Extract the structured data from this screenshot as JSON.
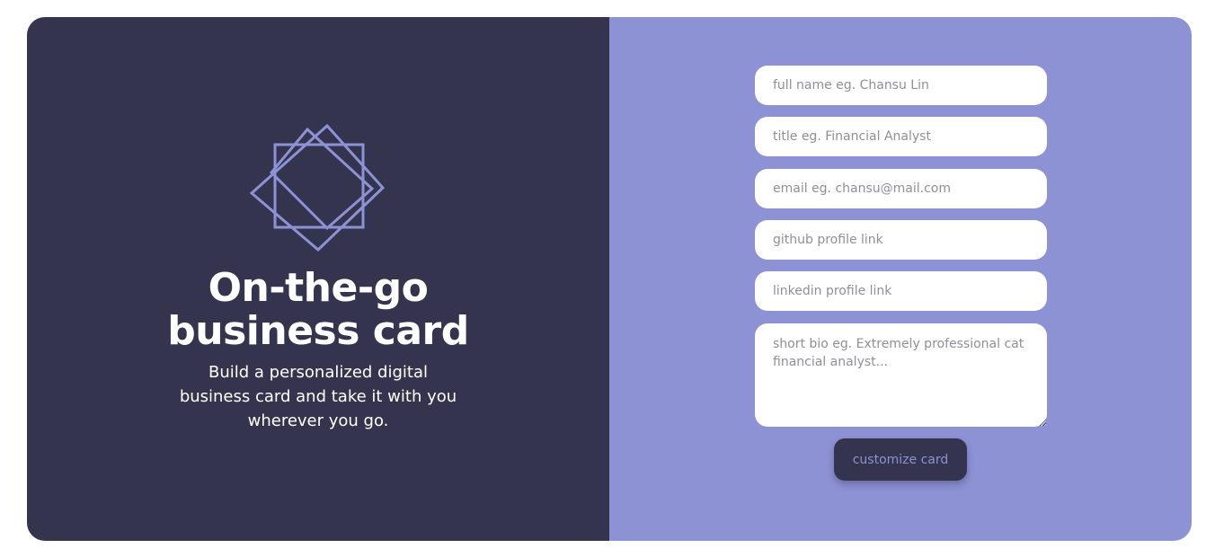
{
  "hero": {
    "logo_icon": "overlapping-squares-icon",
    "title_line1": "On-the-go",
    "title_line2": "business card",
    "subtitle": "Build a personalized digital business card and take it with you wherever you go."
  },
  "form": {
    "full_name": {
      "value": "",
      "placeholder": "full name eg. Chansu Lin"
    },
    "title": {
      "value": "",
      "placeholder": "title eg. Financial Analyst"
    },
    "email": {
      "value": "",
      "placeholder": "email eg. chansu@mail.com"
    },
    "github": {
      "value": "",
      "placeholder": "github profile link"
    },
    "linkedin": {
      "value": "",
      "placeholder": "linkedin profile link"
    },
    "bio": {
      "value": "",
      "placeholder": "short bio eg. Extremely professional cat financial analyst..."
    },
    "submit_label": "customize card"
  },
  "colors": {
    "dark_panel": "#35344e",
    "accent_panel": "#8d92d4",
    "page_background": "#ffffff"
  }
}
